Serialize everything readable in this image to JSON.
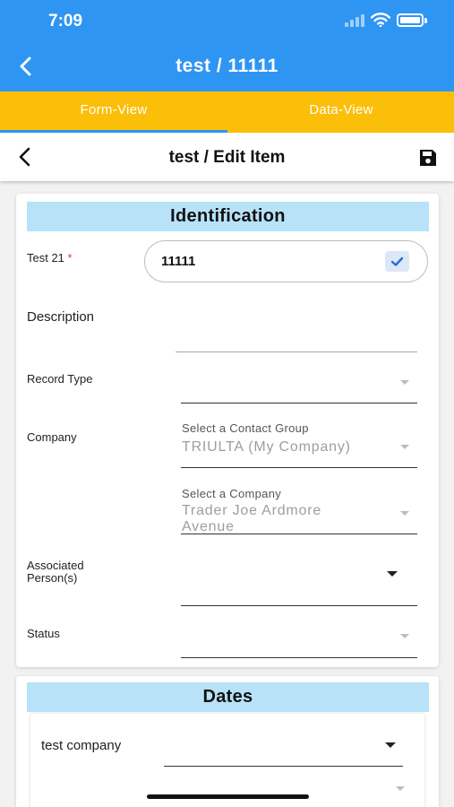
{
  "status_bar": {
    "time": "7:09"
  },
  "app_bar": {
    "title": "test / 11111"
  },
  "tabs": [
    {
      "label": "Form-View"
    },
    {
      "label": "Data-View"
    }
  ],
  "sub_header": {
    "title": "test / Edit Item"
  },
  "identification": {
    "heading": "Identification",
    "test21_label": "Test 21",
    "required_marker": "*",
    "test21_value": "11111",
    "description_label": "Description",
    "record_type_label": "Record Type",
    "company_label": "Company",
    "contact_group_helper": "Select a Contact Group",
    "contact_group_value": "TRIULTA (My Company)",
    "company_helper": "Select a Company",
    "company_value_line1": "Trader Joe Ardmore",
    "company_value_line2": "Avenue",
    "associated_label_line1": "Associated",
    "associated_label_line2": "Person(s)",
    "status_label": "Status"
  },
  "dates": {
    "heading": "Dates",
    "company_label": "test company"
  },
  "colors": {
    "primary": "#2f95f2",
    "tab_bar": "#fbbf0a",
    "section_header": "#b7e2f8",
    "required": "#e53935"
  }
}
